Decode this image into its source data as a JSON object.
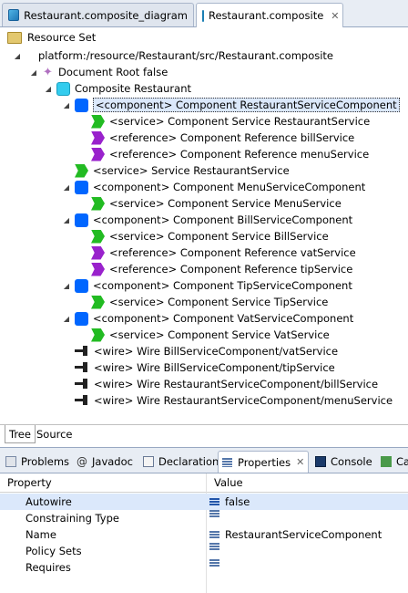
{
  "editor_tabs": [
    {
      "label": "Restaurant.composite_diagram",
      "icon": "diagram-file-icon",
      "active": false
    },
    {
      "label": "Restaurant.composite",
      "icon": "composite-file-icon",
      "active": true,
      "close": "✕"
    }
  ],
  "resource_set": {
    "label": "Resource Set"
  },
  "tree": [
    {
      "label": "platform:/resource/Restaurant/src/Restaurant.composite",
      "icon": "file-icon"
    },
    {
      "label": "Document Root false",
      "icon": "diamond-icon"
    },
    {
      "label": "Composite Restaurant",
      "icon": "composite-icon"
    },
    {
      "label": "<component> Component RestaurantServiceComponent",
      "icon": "component-icon",
      "selected": true
    },
    {
      "label": "<service> Component Service RestaurantService",
      "icon": "service-icon"
    },
    {
      "label": "<reference> Component Reference billService",
      "icon": "reference-icon"
    },
    {
      "label": "<reference> Component Reference menuService",
      "icon": "reference-icon"
    },
    {
      "label": "<service> Service RestaurantService",
      "icon": "service-icon"
    },
    {
      "label": "<component> Component MenuServiceComponent",
      "icon": "component-icon"
    },
    {
      "label": "<service> Component Service MenuService",
      "icon": "service-icon"
    },
    {
      "label": "<component> Component BillServiceComponent",
      "icon": "component-icon"
    },
    {
      "label": "<service> Component Service BillService",
      "icon": "service-icon"
    },
    {
      "label": "<reference> Component Reference vatService",
      "icon": "reference-icon"
    },
    {
      "label": "<reference> Component Reference tipService",
      "icon": "reference-icon"
    },
    {
      "label": "<component> Component TipServiceComponent",
      "icon": "component-icon"
    },
    {
      "label": "<service> Component Service TipService",
      "icon": "service-icon"
    },
    {
      "label": "<component> Component VatServiceComponent",
      "icon": "component-icon"
    },
    {
      "label": "<service> Component Service VatService",
      "icon": "service-icon"
    },
    {
      "label": "<wire> Wire BillServiceComponent/vatService",
      "icon": "wire-icon"
    },
    {
      "label": "<wire> Wire BillServiceComponent/tipService",
      "icon": "wire-icon"
    },
    {
      "label": "<wire> Wire RestaurantServiceComponent/billService",
      "icon": "wire-icon"
    },
    {
      "label": "<wire> Wire RestaurantServiceComponent/menuService",
      "icon": "wire-icon"
    }
  ],
  "editor_bottom_tabs": [
    {
      "label": "Tree",
      "active": true
    },
    {
      "label": "Source",
      "active": false
    }
  ],
  "view_tabs": [
    {
      "label": "Problems",
      "icon": "problems-icon"
    },
    {
      "label": "Javadoc",
      "icon": "at-icon"
    },
    {
      "label": "Declaration",
      "icon": "declaration-icon"
    },
    {
      "label": "Properties",
      "icon": "properties-icon",
      "active": true,
      "close": "✕"
    },
    {
      "label": "Console",
      "icon": "console-icon"
    },
    {
      "label": "Ca",
      "icon": "call-hierarchy-icon"
    }
  ],
  "properties": {
    "headers": {
      "property": "Property",
      "value": "Value"
    },
    "rows": [
      {
        "name": "Autowire",
        "value": "false",
        "selected": true
      },
      {
        "name": "Constraining Type",
        "value": ""
      },
      {
        "name": "Name",
        "value": "RestaurantServiceComponent"
      },
      {
        "name": "Policy Sets",
        "value": ""
      },
      {
        "name": "Requires",
        "value": ""
      }
    ]
  },
  "colors": {
    "component": "#0066ff",
    "service": "#22bb22",
    "reference": "#9922cc",
    "composite": "#33ccee",
    "selection": "#dbe8fb"
  }
}
